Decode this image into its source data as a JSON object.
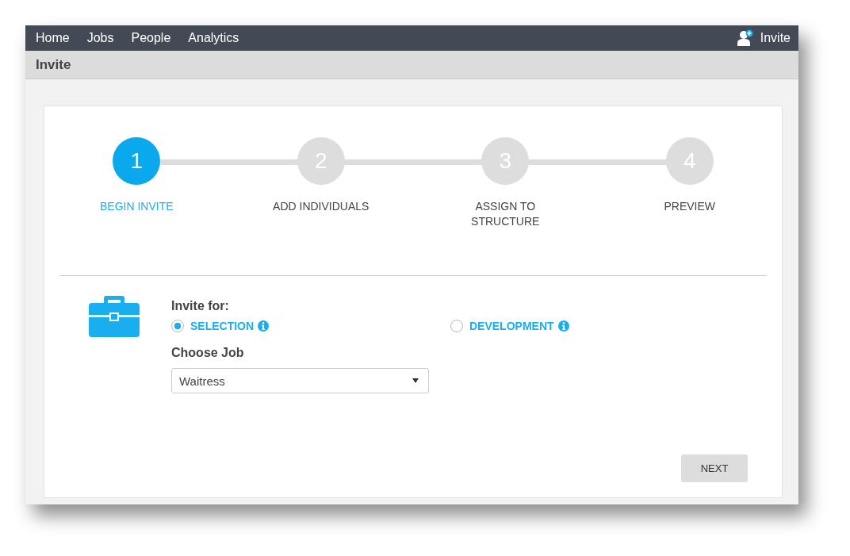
{
  "nav": {
    "items": [
      {
        "label": "Home"
      },
      {
        "label": "Jobs"
      },
      {
        "label": "People"
      },
      {
        "label": "Analytics"
      }
    ],
    "invite": "Invite"
  },
  "page_title": "Invite",
  "steps": [
    {
      "number": "1",
      "label": "BEGIN INVITE",
      "active": true
    },
    {
      "number": "2",
      "label": "ADD INDIVIDUALS",
      "active": false
    },
    {
      "number": "3",
      "label": "ASSIGN TO STRUCTURE",
      "active": false
    },
    {
      "number": "4",
      "label": "PREVIEW",
      "active": false
    }
  ],
  "form": {
    "invite_for_label": "Invite for:",
    "options": [
      {
        "label": "SELECTION",
        "selected": true
      },
      {
        "label": "DEVELOPMENT",
        "selected": false
      }
    ],
    "job_label": "Choose Job",
    "job_value": "Waitress"
  },
  "next_button": "NEXT"
}
